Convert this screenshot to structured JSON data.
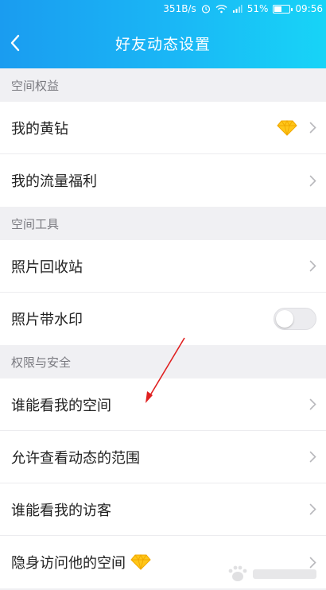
{
  "status_bar": {
    "net_speed": "351B/s",
    "battery": "51%",
    "battery_level": 0.51,
    "time": "09:56"
  },
  "header": {
    "title": "好友动态设置",
    "back_icon": "chevron-left-icon"
  },
  "sections": [
    {
      "title": "空间权益",
      "items": [
        {
          "label": "我的黄钻",
          "badge_icon": "yellow-diamond-icon"
        },
        {
          "label": "我的流量福利"
        }
      ]
    },
    {
      "title": "空间工具",
      "items": [
        {
          "label": "照片回收站"
        },
        {
          "label": "照片带水印",
          "toggle_on": false
        }
      ]
    },
    {
      "title": "权限与安全",
      "items": [
        {
          "label": "谁能看我的空间"
        },
        {
          "label": "允许查看动态的范围"
        },
        {
          "label": "谁能看我的访客"
        },
        {
          "label": "隐身访问他的空间",
          "badge_icon": "yellow-diamond-icon"
        }
      ]
    }
  ],
  "colors": {
    "header_gradient_start": "#1a9cf0",
    "header_gradient_end": "#17d4f7",
    "annotation_arrow": "#e02020",
    "diamond": "#ffc619"
  },
  "watermark_icon": "baidu-jingyan-watermark"
}
